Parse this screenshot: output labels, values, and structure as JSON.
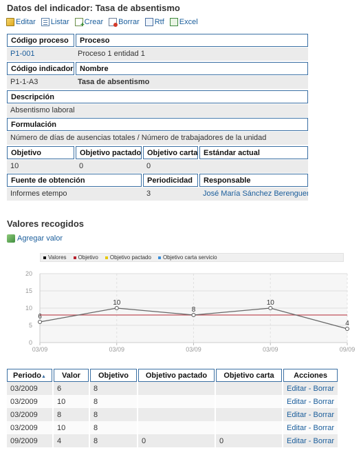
{
  "header": {
    "title": "Datos del indicador: Tasa de absentismo"
  },
  "toolbar": {
    "buttons": [
      {
        "label": "Editar",
        "icon": "edit-icon"
      },
      {
        "label": "Listar",
        "icon": "list-icon"
      },
      {
        "label": "Crear",
        "icon": "create-icon"
      },
      {
        "label": "Borrar",
        "icon": "delete-icon"
      },
      {
        "label": "Rtf",
        "icon": "rtf-icon"
      },
      {
        "label": "Excel",
        "icon": "excel-icon"
      }
    ]
  },
  "indicator": {
    "codigo_proceso_label": "Código proceso",
    "proceso_label": "Proceso",
    "codigo_proceso": "P1-001",
    "proceso": "Proceso 1 entidad 1",
    "codigo_indicador_label": "Código indicador",
    "nombre_label": "Nombre",
    "codigo_indicador": "P1-1-A3",
    "nombre": "Tasa de absentismo",
    "descripcion_label": "Descripción",
    "descripcion": "Absentismo laboral",
    "formulacion_label": "Formulación",
    "formulacion": "Número de días de ausencias totales / Número de trabajadores de la unidad",
    "objetivo_label": "Objetivo",
    "objetivo_pactado_label": "Objetivo pactado",
    "objetivo_carta_label": "Objetivo carta",
    "estandar_actual_label": "Estándar actual",
    "objetivo": "10",
    "objetivo_pactado": "0",
    "objetivo_carta": "0",
    "estandar_actual": "",
    "fuente_label": "Fuente de obtención",
    "periodicidad_label": "Periodicidad",
    "responsable_label": "Responsable",
    "fuente": "Informes etempo",
    "periodicidad": "3",
    "responsable": "José María Sánchez Berenguer"
  },
  "valores": {
    "title": "Valores recogidos",
    "add_label": "Agregar valor"
  },
  "chart_data": {
    "type": "line",
    "x": [
      "03/09",
      "03/09",
      "03/09",
      "03/09",
      "09/09"
    ],
    "series": [
      {
        "name": "Valores",
        "values": [
          6,
          10,
          8,
          10,
          4
        ],
        "color": "#666666"
      },
      {
        "name": "Objetivo",
        "values": [
          8,
          8,
          8,
          8,
          8
        ],
        "color": "#c0505a"
      },
      {
        "name": "Objetivo pactado",
        "values": [],
        "color": "#e6c800"
      },
      {
        "name": "Objetivo carta servicio",
        "values": [],
        "color": "#3b8fd9"
      }
    ],
    "yticks": [
      "0",
      "5",
      "10",
      "15",
      "20"
    ],
    "ylim": [
      0,
      20
    ],
    "grid": true,
    "legend": "top"
  },
  "table": {
    "headers": [
      "Periodo",
      "Valor",
      "Objetivo",
      "Objetivo pactado",
      "Objetivo carta",
      "Acciones"
    ],
    "sort_indicator": "▲",
    "rows": [
      {
        "periodo": "03/2009",
        "valor": "6",
        "objetivo": "8",
        "pactado": "",
        "carta": "",
        "editar": "Editar",
        "sep": " - ",
        "borrar": "Borrar"
      },
      {
        "periodo": "03/2009",
        "valor": "10",
        "objetivo": "8",
        "pactado": "",
        "carta": "",
        "editar": "Editar",
        "sep": " - ",
        "borrar": "Borrar"
      },
      {
        "periodo": "03/2009",
        "valor": "8",
        "objetivo": "8",
        "pactado": "",
        "carta": "",
        "editar": "Editar",
        "sep": " - ",
        "borrar": "Borrar"
      },
      {
        "periodo": "03/2009",
        "valor": "10",
        "objetivo": "8",
        "pactado": "",
        "carta": "",
        "editar": "Editar",
        "sep": " - ",
        "borrar": "Borrar"
      },
      {
        "periodo": "09/2009",
        "valor": "4",
        "objetivo": "8",
        "pactado": "0",
        "carta": "0",
        "editar": "Editar",
        "sep": " - ",
        "borrar": "Borrar"
      }
    ]
  }
}
